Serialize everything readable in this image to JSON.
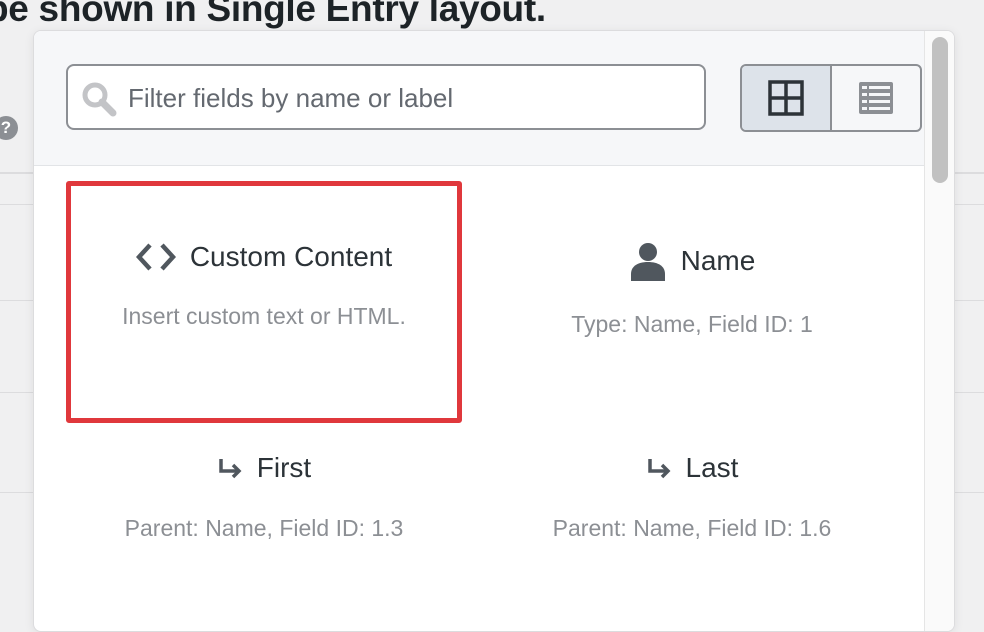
{
  "background": {
    "heading": "pe shown in Single Entry layout.",
    "help_glyph": "?"
  },
  "search": {
    "placeholder": "Filter fields by name or label",
    "value": ""
  },
  "view_toggle": {
    "grid_icon": "grid-icon",
    "list_icon": "list-icon",
    "active": "grid"
  },
  "fields": [
    {
      "icon": "code-icon",
      "title": "Custom Content",
      "subtitle": "Insert custom text or HTML."
    },
    {
      "icon": "user-icon",
      "title": "Name",
      "subtitle": "Type: Name, Field ID: 1"
    },
    {
      "icon": "subfield-arrow-icon",
      "title": "First",
      "subtitle": "Parent: Name, Field ID: 1.3"
    },
    {
      "icon": "subfield-arrow-icon",
      "title": "Last",
      "subtitle": "Parent: Name, Field ID: 1.6"
    }
  ],
  "colors": {
    "highlight": "#e0383c",
    "icon": "#50575e",
    "muted_text": "#8c8f94"
  }
}
